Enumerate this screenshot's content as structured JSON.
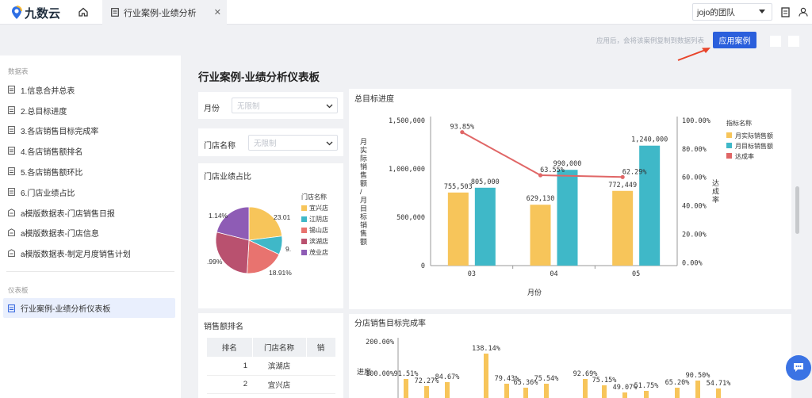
{
  "app": {
    "logo_text": "九数云"
  },
  "tab": {
    "title": "行业案例-业绩分析"
  },
  "team": {
    "name": "jojo的团队"
  },
  "toolbar": {
    "hint": "应用后，会将该案例复制到数据列表",
    "apply_label": "应用案例"
  },
  "sidebar": {
    "section_data": "数据表",
    "items": [
      "1.信息合并总表",
      "2.总目标进度",
      "3.各店销售目标完成率",
      "4.各店销售额排名",
      "5.各店销售额环比",
      "6.门店业绩占比",
      "a模版数据表-门店销售日报",
      "a模版数据表-门店信息",
      "a模版数据表-制定月度销售计划"
    ],
    "section_dash": "仪表板",
    "active_item": "行业案例-业绩分析仪表板"
  },
  "page": {
    "title": "行业案例-业绩分析仪表板"
  },
  "filters": {
    "month": {
      "label": "月份",
      "placeholder": "无限制"
    },
    "store": {
      "label": "门店名称",
      "placeholder": "无限制"
    }
  },
  "colors": {
    "actual": "#f7c55a",
    "target": "#3fb8c8",
    "rate": "#e06666",
    "accent": "#2b5fdc"
  },
  "pie": {
    "title": "门店业绩占比",
    "legend_title": "门店名称",
    "stores": [
      "宜兴店",
      "江阴店",
      "锡山店",
      "滨湖店",
      "茂业店"
    ],
    "colors": [
      "#f7c55a",
      "#3fb8c8",
      "#e8736f",
      "#b9516f",
      "#8e5cb5"
    ],
    "labels": [
      "23.01",
      "9.",
      "18.91%",
      ".99%",
      "1.14%"
    ]
  },
  "rank": {
    "title": "销售额排名",
    "headers": [
      "排名",
      "门店名称",
      "销"
    ],
    "rows": [
      [
        "1",
        "滨湖店"
      ],
      [
        "2",
        "宜兴店"
      ]
    ]
  },
  "chart_data": [
    {
      "type": "bar",
      "title": "总目标进度",
      "categories": [
        "03",
        "04",
        "05"
      ],
      "xlabel": "月份",
      "ylabel": "月实际销售额/月目标销售额",
      "y2label": "达成率",
      "ylim": [
        0,
        1500000
      ],
      "y_ticks": [
        "1,500,000",
        "1,000,000",
        "500,000",
        "0"
      ],
      "y2_ticks": [
        "100.00%",
        "80.00%",
        "60.00%",
        "40.00%",
        "20.00%",
        "0.00%"
      ],
      "legend_title": "指标名称",
      "series": [
        {
          "name": "月实际销售额",
          "values": [
            755503,
            629130,
            772449
          ],
          "labels": [
            "755,503",
            "629,130",
            "772,449"
          ]
        },
        {
          "name": "月目标销售额",
          "values": [
            805000,
            990000,
            1240000
          ],
          "labels": [
            "805,000",
            "990,000",
            "1,240,000"
          ]
        },
        {
          "name": "达成率",
          "values": [
            93.85,
            63.55,
            62.29
          ],
          "labels": [
            "93.85%",
            "63.55%",
            "62.29%"
          ]
        }
      ]
    },
    {
      "type": "bar",
      "title": "分店销售目标完成率",
      "ylabel": "进度",
      "y_ticks": [
        "200.00%",
        "100.00%"
      ],
      "values": [
        91.51,
        72.27,
        84.67,
        138.14,
        79.43,
        65.36,
        75.54,
        92.69,
        75.15,
        49.07,
        51.75,
        65.2,
        90.5,
        54.71
      ],
      "labels": [
        "91.51%",
        "72.27%",
        "84.67%",
        "138.14%",
        "79.43%",
        "65.36%",
        "75.54%",
        "92.69%",
        "75.15%",
        "49.07%",
        "51.75%",
        "65.20%",
        "90.50%",
        "54.71%"
      ]
    }
  ]
}
